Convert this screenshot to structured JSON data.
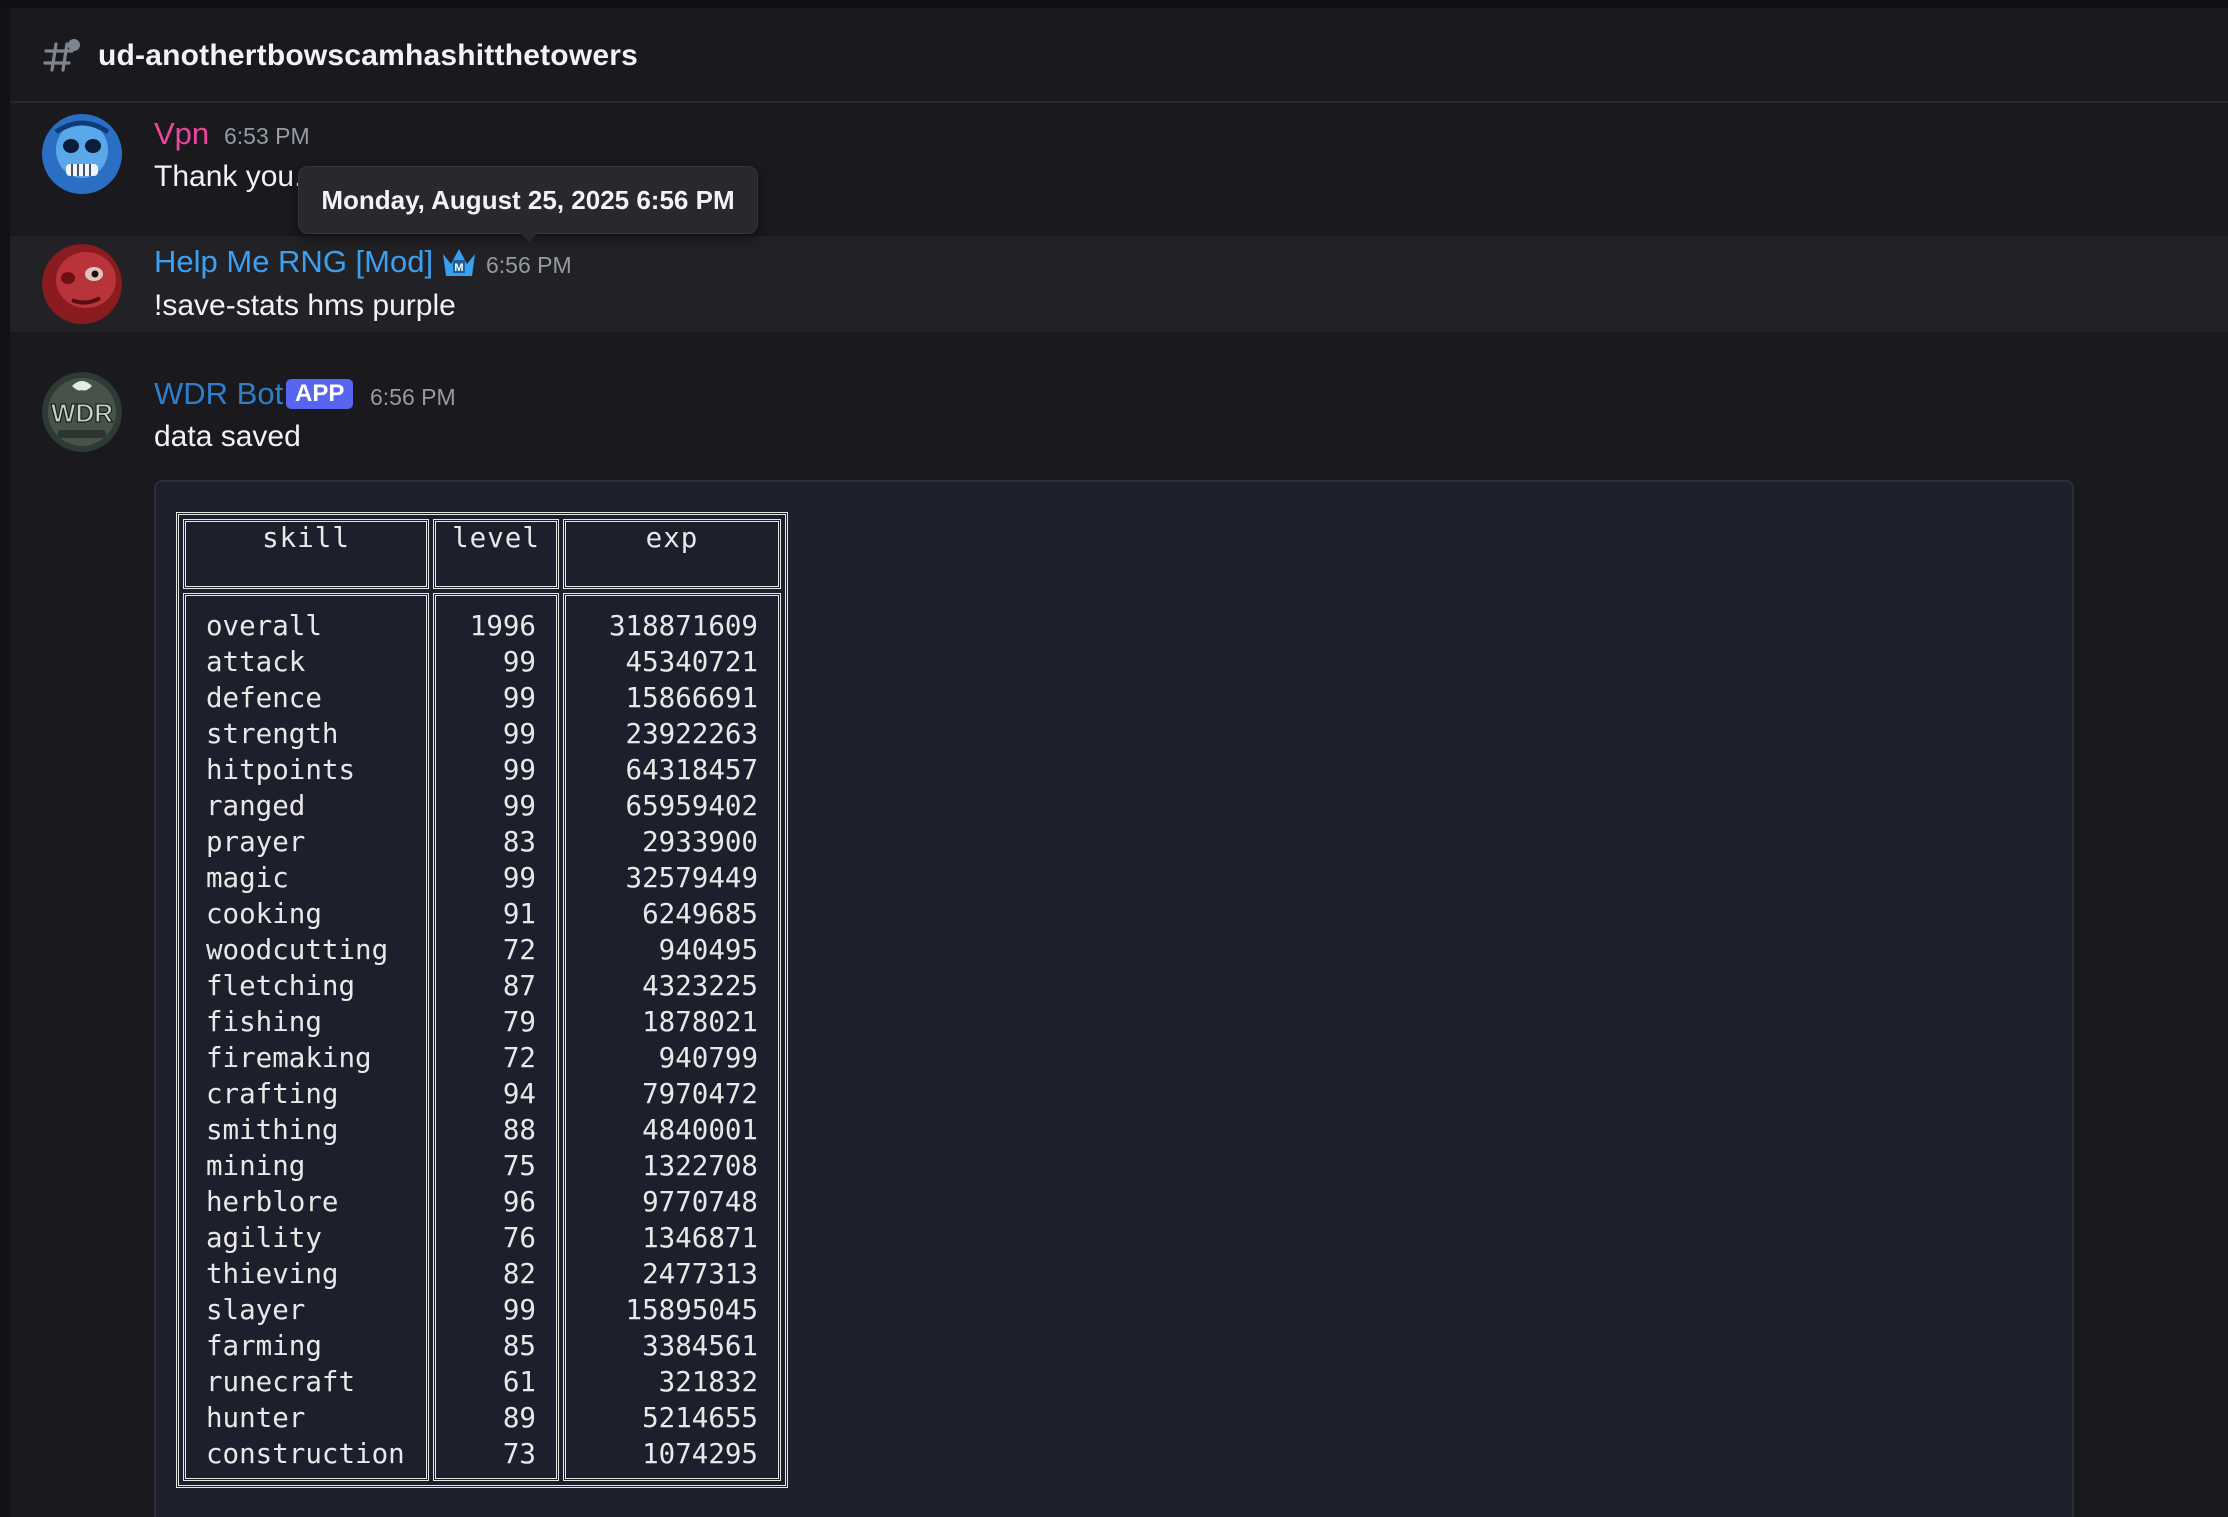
{
  "channel": {
    "name": "ud-anothertbowscamhashitthetowers",
    "icon": "hash-thread-icon"
  },
  "tooltip": {
    "text": "Monday, August 25, 2025 6:56 PM"
  },
  "messages": [
    {
      "author": "Vpn",
      "author_color": "#eb459e",
      "time": "6:53 PM",
      "text": "Thank you.",
      "avatar": "blue-skull-avatar"
    },
    {
      "author": "Help Me RNG [Mod]",
      "author_color": "#3ba0f0",
      "time": "6:56 PM",
      "text": "!save-stats hms purple",
      "avatar": "red-face-avatar",
      "badge_icon": "moderator-crown-icon"
    },
    {
      "author": "WDR Bot",
      "author_color": "#2d7fc9",
      "badge": "APP",
      "time": "6:56 PM",
      "text": "data saved",
      "avatar": "wdr-logo-avatar"
    }
  ],
  "table": {
    "headers": [
      "skill",
      "level",
      "exp"
    ],
    "rows": [
      [
        "overall",
        "1996",
        "318871609"
      ],
      [
        "attack",
        "99",
        "45340721"
      ],
      [
        "defence",
        "99",
        "15866691"
      ],
      [
        "strength",
        "99",
        "23922263"
      ],
      [
        "hitpoints",
        "99",
        "64318457"
      ],
      [
        "ranged",
        "99",
        "65959402"
      ],
      [
        "prayer",
        "83",
        "2933900"
      ],
      [
        "magic",
        "99",
        "32579449"
      ],
      [
        "cooking",
        "91",
        "6249685"
      ],
      [
        "woodcutting",
        "72",
        "940495"
      ],
      [
        "fletching",
        "87",
        "4323225"
      ],
      [
        "fishing",
        "79",
        "1878021"
      ],
      [
        "firemaking",
        "72",
        "940799"
      ],
      [
        "crafting",
        "94",
        "7970472"
      ],
      [
        "smithing",
        "88",
        "4840001"
      ],
      [
        "mining",
        "75",
        "1322708"
      ],
      [
        "herblore",
        "96",
        "9770748"
      ],
      [
        "agility",
        "76",
        "1346871"
      ],
      [
        "thieving",
        "82",
        "2477313"
      ],
      [
        "slayer",
        "99",
        "15895045"
      ],
      [
        "farming",
        "85",
        "3384561"
      ],
      [
        "runecraft",
        "61",
        "321832"
      ],
      [
        "hunter",
        "89",
        "5214655"
      ],
      [
        "construction",
        "73",
        "1074295"
      ]
    ]
  }
}
